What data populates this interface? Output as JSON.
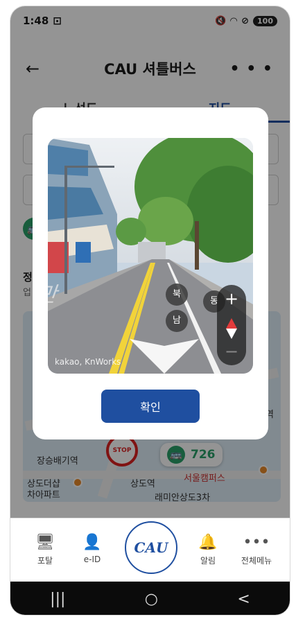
{
  "status_bar": {
    "time": "1:48",
    "battery": "100"
  },
  "header": {
    "back_icon": "←",
    "title": "CAU 셔틀버스",
    "more_icon": "⋮"
  },
  "tabs": [
    {
      "label": "노선도"
    },
    {
      "label": "지도"
    }
  ],
  "background": {
    "info_heading": "정",
    "info_sub": "업",
    "map_labels": [
      "장승배기역",
      "상도더샵",
      "차아파트",
      "상도역",
      "래미안상도3차",
      "서울캠퍼스",
      "역"
    ],
    "bus_number": "726",
    "stop_label": "STOP"
  },
  "modal": {
    "road_marking": "만",
    "direction_labels": {
      "north": "북",
      "south": "남",
      "east": "동"
    },
    "zoom_in": "+",
    "zoom_out": "−",
    "watermark": "kakao, KnWorks",
    "confirm_label": "확인"
  },
  "bottom_nav": {
    "items": [
      {
        "label": "포탈",
        "icon": "portal-icon"
      },
      {
        "label": "e-ID",
        "icon": "id-card-icon"
      },
      {
        "label": "알림",
        "icon": "bell-icon"
      },
      {
        "label": "전체메뉴",
        "icon": "more-dots-icon"
      }
    ],
    "center_logo": "CAU"
  },
  "system_nav": {
    "recent": "|||",
    "home": "○",
    "back": "<"
  },
  "colors": {
    "primary": "#1f4fa0",
    "bus_green": "#2aa06a",
    "stop_red": "#dd2222"
  }
}
